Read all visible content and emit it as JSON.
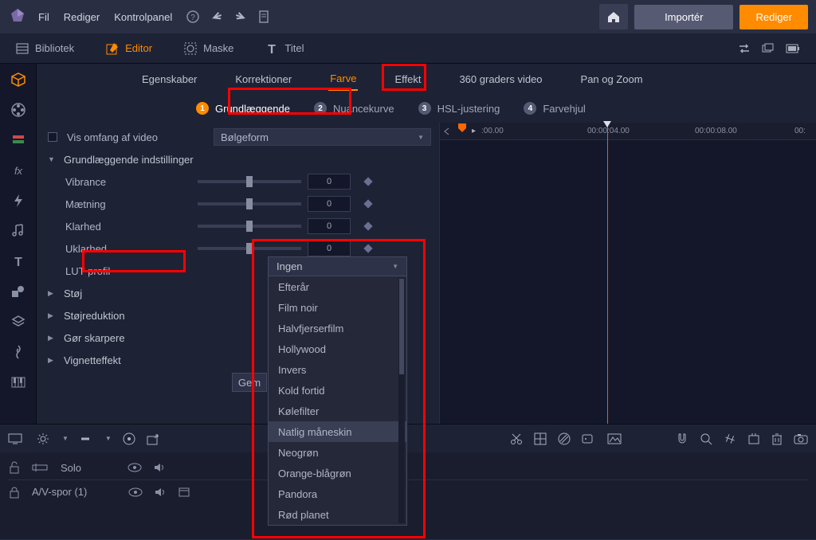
{
  "menu": {
    "file": "Fil",
    "edit": "Rediger",
    "control": "Kontrolpanel"
  },
  "topbar": {
    "import": "Importér",
    "editBtn": "Rediger"
  },
  "modes": {
    "library": "Bibliotek",
    "editor": "Editor",
    "mask": "Maske",
    "title": "Titel"
  },
  "subtabs": {
    "properties": "Egenskaber",
    "corrections": "Korrektioner",
    "color": "Farve",
    "effect": "Effekt",
    "video360": "360 graders video",
    "panzoom": "Pan og Zoom"
  },
  "steps": {
    "s1": "Grundlæggende",
    "s2": "Nuancekurve",
    "s3": "HSL-justering",
    "s4": "Farvehjul"
  },
  "settings": {
    "showScope": "Vis omfang af video",
    "waveform": "Bølgeform",
    "basicHeader": "Grundlæggende indstillinger",
    "vibrance": "Vibrance",
    "saturation": "Mætning",
    "clarity": "Klarhed",
    "haze": "Uklarhed",
    "lutprofile": "LUT-profil",
    "noise": "Støj",
    "noiseReduction": "Støjreduktion",
    "sharpen": "Gør skarpere",
    "vignette": "Vignetteffekt",
    "zero": "0",
    "save": "Gem"
  },
  "lut": {
    "selected": "Ingen",
    "options": [
      "Efterår",
      "Film noir",
      "Halvfjerserfilm",
      "Hollywood",
      "Invers",
      "Kold fortid",
      "Kølefilter",
      "Natlig måneskin",
      "Neogrøn",
      "Orange-blågrøn",
      "Pandora",
      "Rød planet"
    ]
  },
  "timeline": {
    "t0": ":00.00",
    "t1": "00:00:04.00",
    "t2": "00:00:08.00",
    "t3": "00:"
  },
  "tracks": {
    "solo": "Solo",
    "av": "A/V-spor (1)"
  }
}
